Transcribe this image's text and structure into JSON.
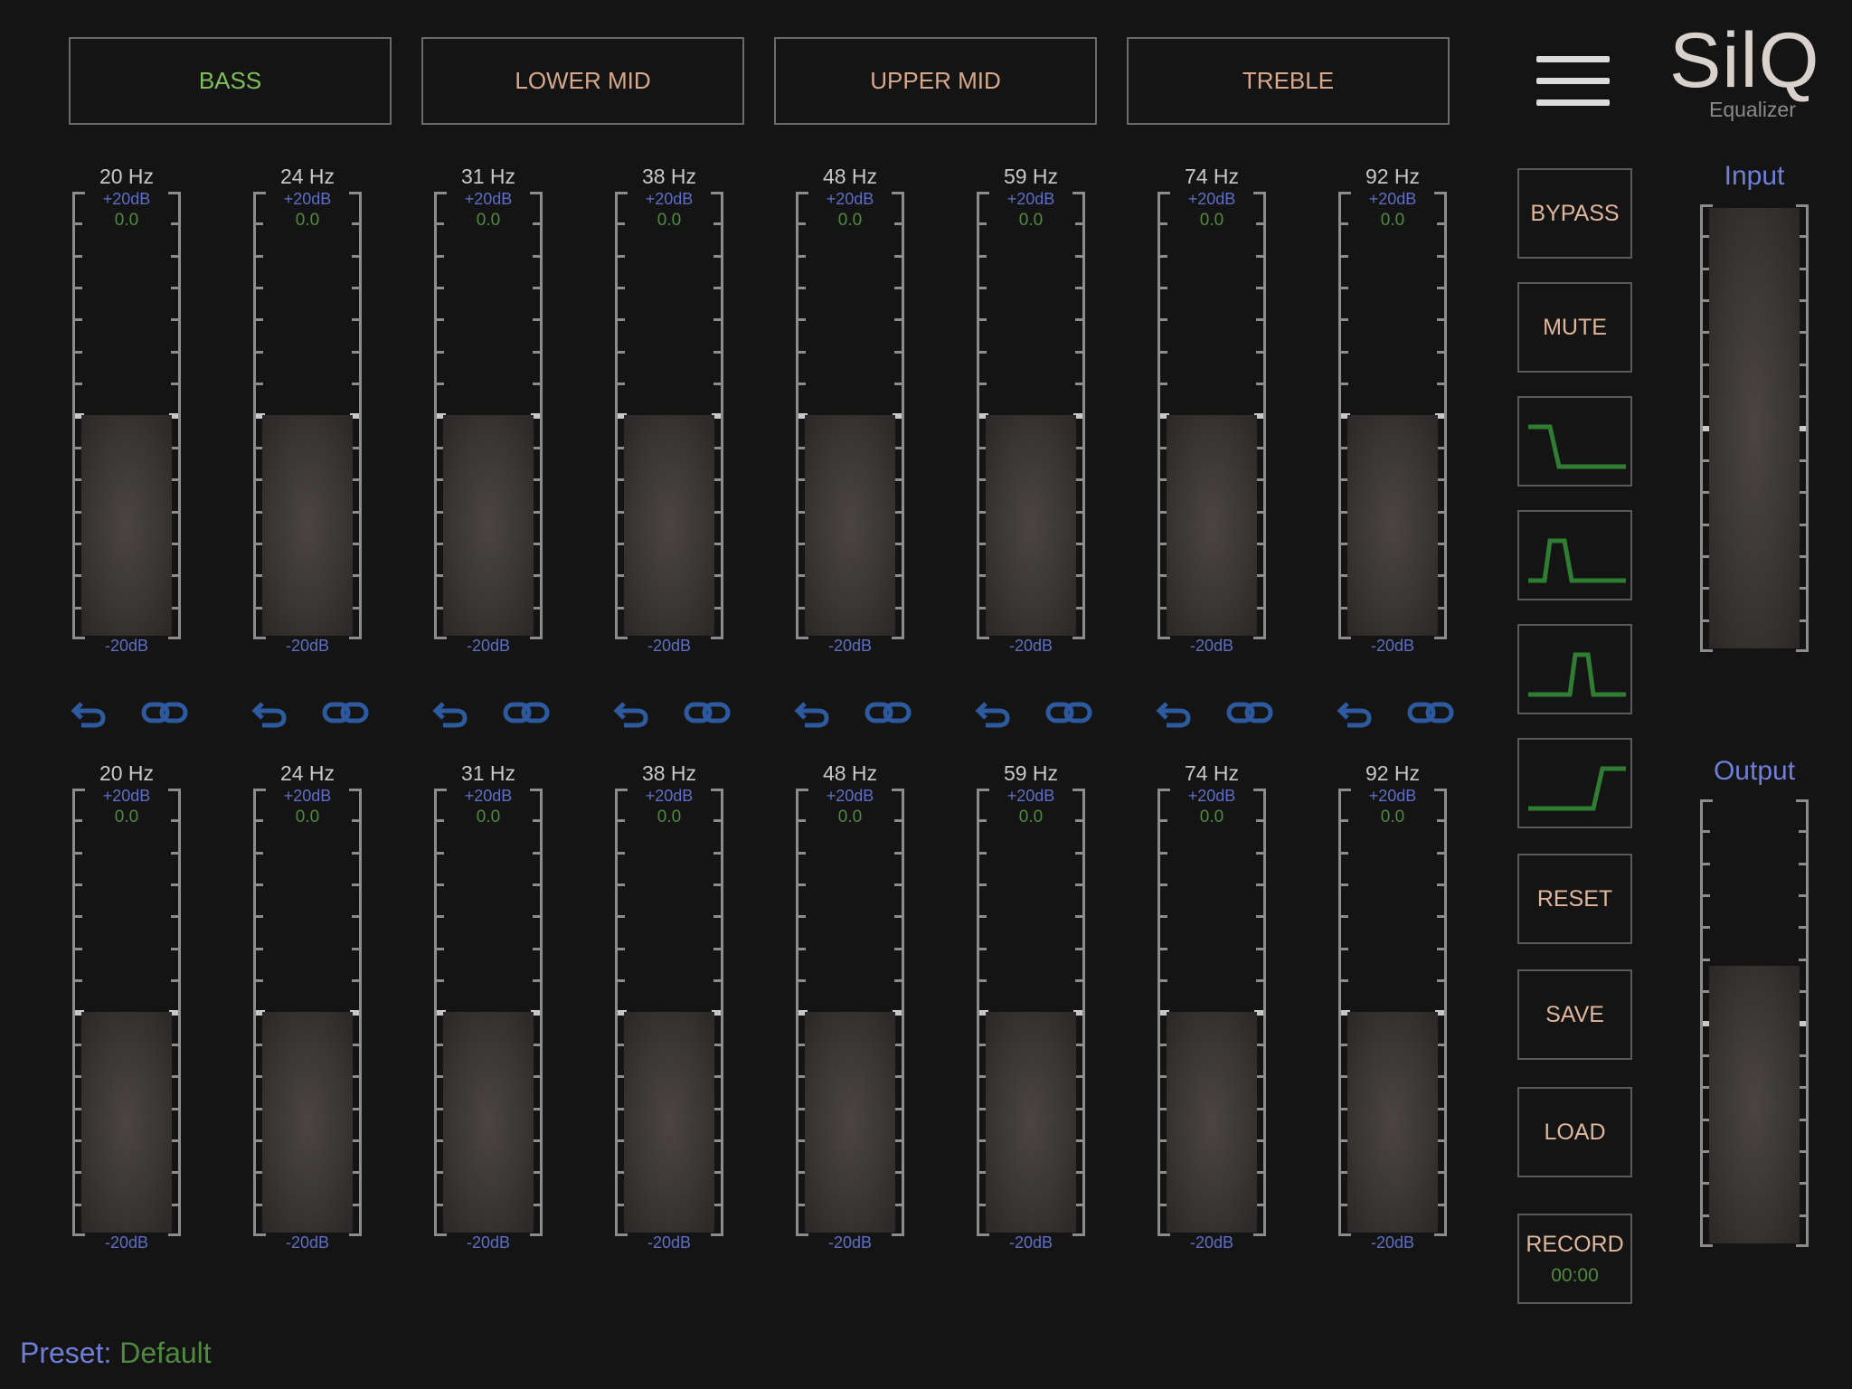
{
  "tabs": [
    {
      "label": "BASS",
      "active": true
    },
    {
      "label": "LOWER MID",
      "active": false
    },
    {
      "label": "UPPER MID",
      "active": false
    },
    {
      "label": "TREBLE",
      "active": false
    }
  ],
  "logo": {
    "title": "SilQ",
    "subtitle": "Equalizer"
  },
  "sliders_top": [
    {
      "freq": "20 Hz",
      "max": "+20dB",
      "value": "0.0",
      "min": "-20dB",
      "level": 0.5
    },
    {
      "freq": "24 Hz",
      "max": "+20dB",
      "value": "0.0",
      "min": "-20dB",
      "level": 0.5
    },
    {
      "freq": "31 Hz",
      "max": "+20dB",
      "value": "0.0",
      "min": "-20dB",
      "level": 0.5
    },
    {
      "freq": "38 Hz",
      "max": "+20dB",
      "value": "0.0",
      "min": "-20dB",
      "level": 0.5
    },
    {
      "freq": "48 Hz",
      "max": "+20dB",
      "value": "0.0",
      "min": "-20dB",
      "level": 0.5
    },
    {
      "freq": "59 Hz",
      "max": "+20dB",
      "value": "0.0",
      "min": "-20dB",
      "level": 0.5
    },
    {
      "freq": "74 Hz",
      "max": "+20dB",
      "value": "0.0",
      "min": "-20dB",
      "level": 0.5
    },
    {
      "freq": "92 Hz",
      "max": "+20dB",
      "value": "0.0",
      "min": "-20dB",
      "level": 0.5
    }
  ],
  "sliders_bottom": [
    {
      "freq": "20 Hz",
      "max": "+20dB",
      "value": "0.0",
      "min": "-20dB",
      "level": 0.5
    },
    {
      "freq": "24 Hz",
      "max": "+20dB",
      "value": "0.0",
      "min": "-20dB",
      "level": 0.5
    },
    {
      "freq": "31 Hz",
      "max": "+20dB",
      "value": "0.0",
      "min": "-20dB",
      "level": 0.5
    },
    {
      "freq": "38 Hz",
      "max": "+20dB",
      "value": "0.0",
      "min": "-20dB",
      "level": 0.5
    },
    {
      "freq": "48 Hz",
      "max": "+20dB",
      "value": "0.0",
      "min": "-20dB",
      "level": 0.5
    },
    {
      "freq": "59 Hz",
      "max": "+20dB",
      "value": "0.0",
      "min": "-20dB",
      "level": 0.5
    },
    {
      "freq": "74 Hz",
      "max": "+20dB",
      "value": "0.0",
      "min": "-20dB",
      "level": 0.5
    },
    {
      "freq": "92 Hz",
      "max": "+20dB",
      "value": "0.0",
      "min": "-20dB",
      "level": 0.5
    }
  ],
  "side_buttons": {
    "bypass": "BYPASS",
    "mute": "MUTE",
    "reset": "RESET",
    "save": "SAVE",
    "load": "LOAD",
    "record": "RECORD",
    "record_time": "00:00"
  },
  "filters": [
    "low-pass-filter-icon",
    "wide-band-filter-icon",
    "narrow-band-filter-icon",
    "high-pass-filter-icon"
  ],
  "meters": {
    "input": {
      "title": "Input",
      "level": 1.0
    },
    "output": {
      "title": "Output",
      "level": 0.63
    }
  },
  "preset": {
    "label": "Preset:",
    "value": "Default"
  },
  "colors": {
    "background": "#141414",
    "tab_active": "#7fbf5a",
    "tab_inactive": "#d9a88b",
    "db_label": "#5d6ec4",
    "value_green": "#4f8a3e",
    "icon_blue": "#2d5a9e",
    "filter_green": "#2e7d32"
  }
}
